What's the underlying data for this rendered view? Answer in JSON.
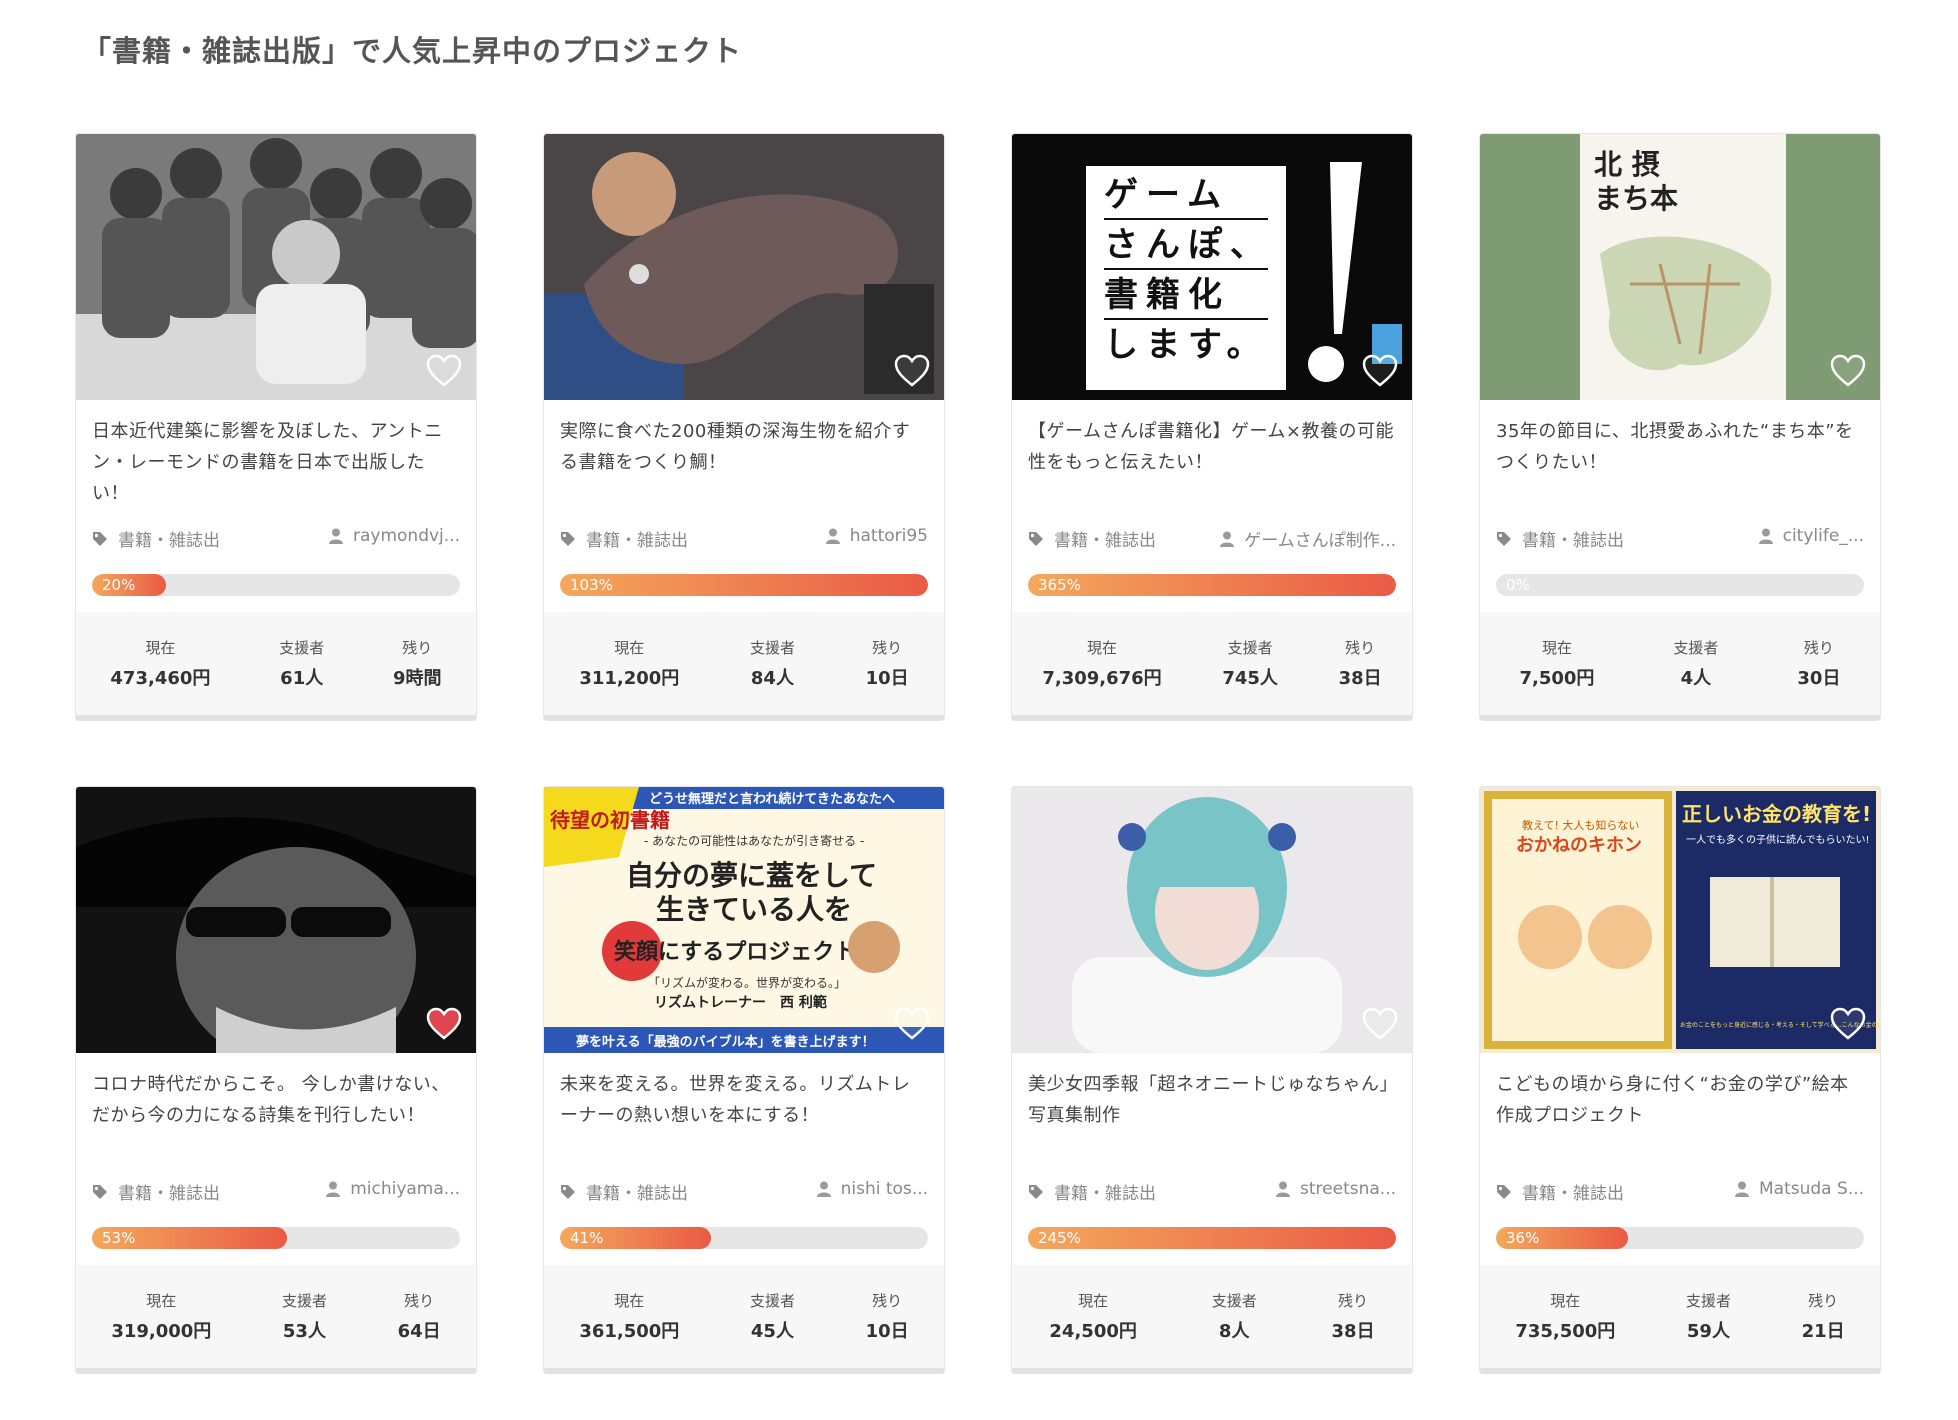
{
  "section": {
    "title": "「書籍・雑誌出版」で人気上昇中のプロジェクト"
  },
  "colors": {
    "progress_start": "#f3a85c",
    "progress_end": "#ea5a45",
    "heart_active": "#e0444e"
  },
  "stat_labels": {
    "current": "現在",
    "backers": "支援者",
    "remaining": "残り"
  },
  "projects": [
    {
      "title": "日本近代建築に影響を及ぼした、アントニン・レーモンドの書籍を日本で出版したい！",
      "category": "書籍・雑誌出",
      "owner": "raymondvj...",
      "percent_label": "20%",
      "progress": 0.2,
      "current": "473,460円",
      "backers": "61人",
      "remaining": "9時間",
      "favorited": false,
      "image": {
        "description": "black-and-white photo of men gathered around a drafting table",
        "bg": "#6b6b6b"
      }
    },
    {
      "title": "実際に食べた200種類の深海生物を紹介する書籍をつくり鯛！",
      "category": "書籍・雑誌出",
      "owner": "hattori95",
      "percent_label": "103%",
      "progress": 1.0,
      "current": "311,200円",
      "backers": "84人",
      "remaining": "10日",
      "favorited": false,
      "image": {
        "description": "man holding a large deep sea eel-like fish in a kitchen",
        "bg": "#3b3a3e"
      }
    },
    {
      "title": "【ゲームさんぽ書籍化】ゲーム×教養の可能性をもっと伝えたい！",
      "category": "書籍・雑誌出",
      "owner": "ゲームさんぽ制作...",
      "percent_label": "365%",
      "progress": 1.0,
      "current": "7,309,676円",
      "backers": "745人",
      "remaining": "38日",
      "favorited": false,
      "image": {
        "text_lines": [
          "ゲーム",
          "さんぽ、",
          "書籍化",
          "します。"
        ],
        "bg": "#0a0a0a"
      }
    },
    {
      "title": "35年の節目に、北摂愛あふれた“まち本”をつくりたい！",
      "category": "書籍・雑誌出",
      "owner": "citylife_...",
      "percent_label": "0%",
      "progress": 0.0,
      "current": "7,500円",
      "backers": "4人",
      "remaining": "30日",
      "favorited": false,
      "image": {
        "text_lines": [
          "北 摂",
          "まち本"
        ],
        "bg": "#7f9b73"
      }
    },
    {
      "title": "コロナ時代だからこそ。 今しか書けない、だから今の力になる詩集を刊行したい！",
      "category": "書籍・雑誌出",
      "owner": "michiyama...",
      "percent_label": "53%",
      "progress": 0.53,
      "current": "319,000円",
      "backers": "53人",
      "remaining": "64日",
      "favorited": true,
      "image": {
        "description": "black-and-white portrait of a man with sunglasses and beard",
        "bg": "#151515"
      }
    },
    {
      "title": "未来を変える。世界を変える。リズムトレーナーの熱い想いを本にする！",
      "category": "書籍・雑誌出",
      "owner": "nishi tos...",
      "percent_label": "41%",
      "progress": 0.41,
      "current": "361,500円",
      "backers": "45人",
      "remaining": "10日",
      "favorited": false,
      "image": {
        "badge": "待望の初書籍",
        "banner": "どうせ無理だと言われ続けてきたあなたへ",
        "subtitle": "- あなたの可能性はあなたが引き寄せる -",
        "headline1": "自分の夢に蓋をして",
        "headline2": "生きている人を",
        "headline3": "笑顔にするプロジェクト",
        "quote": "「リズムが変わる。世界が変わる。」",
        "person": "リズムトレーナー　西 利範",
        "footer": "夢を叶える「最強のバイブル本」を書き上げます！",
        "bg": "#fdf7e4"
      }
    },
    {
      "title": "美少女四季報「超ネオニートじゅなちゃん」写真集制作",
      "category": "書籍・雑誌出",
      "owner": "streetsna...",
      "percent_label": "245%",
      "progress": 1.0,
      "current": "24,500円",
      "backers": "8人",
      "remaining": "38日",
      "favorited": false,
      "image": {
        "description": "person with blue bob hair in white sweater posing",
        "bg": "#e9e6ea"
      }
    },
    {
      "title": "こどもの頃から身に付く“お金の学び”絵本作成プロジェクト",
      "category": "書籍・雑誌出",
      "owner": "Matsuda S...",
      "percent_label": "36%",
      "progress": 0.36,
      "current": "735,500円",
      "backers": "59人",
      "remaining": "21日",
      "favorited": false,
      "image": {
        "left_title": "おかねのキホン",
        "left_sub": "教えて! 大人も知らない",
        "right_title": "正しいお金の教育を!",
        "right_sub": "一人でも多くの子供に読んでもらいたい!",
        "right_bottom": "お金のことをもっと身近に感じる・考える・そして学べる…こんなお金の絵本があったらいいのに!を実現しました!",
        "bg": "#f5ead2"
      }
    }
  ]
}
